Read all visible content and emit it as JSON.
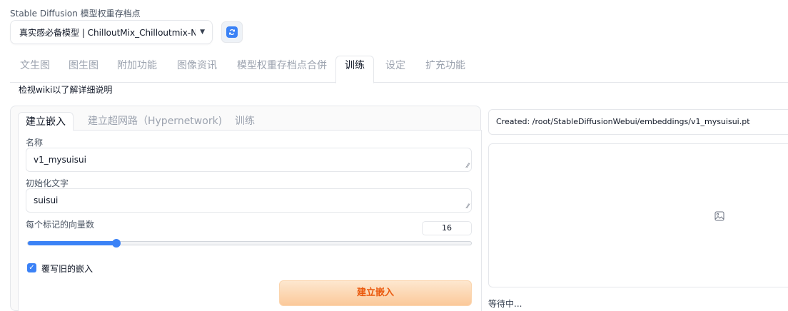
{
  "checkpoint": {
    "label": "Stable Diffusion 模型权重存档点",
    "value": "真实感必备模型 | ChilloutMix_Chilloutmix-Ni-p"
  },
  "top_tabs": [
    {
      "label": "文生图"
    },
    {
      "label": "图生图"
    },
    {
      "label": "附加功能"
    },
    {
      "label": "图像资讯"
    },
    {
      "label": "模型权重存档点合併"
    },
    {
      "label": "训练"
    },
    {
      "label": "设定"
    },
    {
      "label": "扩充功能"
    }
  ],
  "help_text": "检视wiki以了解详细说明",
  "sub_tabs": [
    {
      "label": "建立嵌入"
    },
    {
      "label": "建立超网路（Hypernetwork)"
    },
    {
      "label": "训练"
    }
  ],
  "form": {
    "name_label": "名称",
    "name_value": "v1_mysuisui",
    "init_text_label": "初始化文字",
    "init_text_value": "suisui",
    "vectors_label": "每个标记的向量数",
    "vectors_value": "16",
    "vectors_fraction": 0.2,
    "overwrite_label": "覆写旧的嵌入",
    "overwrite_checked": true,
    "create_button": "建立嵌入"
  },
  "output": {
    "message": "Created: /root/StableDiffusionWebui/embeddings/v1_mysuisui.pt",
    "status": "等待中..."
  },
  "colors": {
    "accent": "#3b82f6",
    "primary_button_text": "#ea580c"
  }
}
